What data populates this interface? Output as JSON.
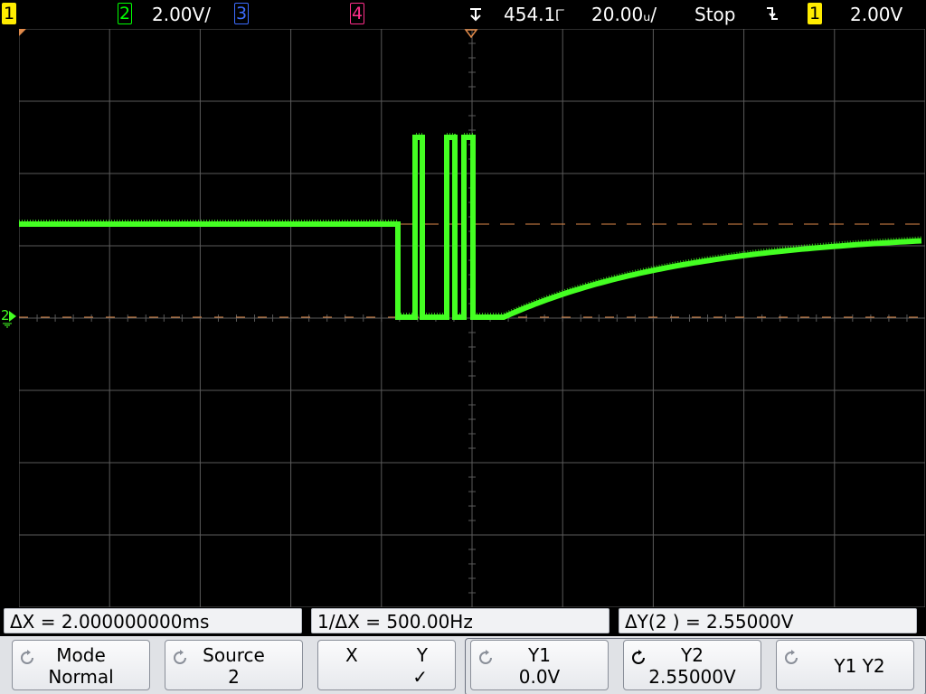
{
  "top_bar": {
    "ch1_badge": "1",
    "ch2_badge": "2",
    "ch2_scale": "2.00V/",
    "ch3_badge": "3",
    "ch4_badge": "4",
    "delay": "454.1୮",
    "delay_icon": "delay-arrow-icon",
    "time_scale": "20.00ᵤ/",
    "run_state": "Stop",
    "trigger_slope_icon": "falling-edge-icon",
    "trigger_source_badge": "1",
    "trigger_level": "2.00V"
  },
  "screen": {
    "ground_marker_label": "2",
    "colors": {
      "grid": "#5a5a5a",
      "trace": "#44ff22",
      "cursor_line": "#e08a4a"
    }
  },
  "readouts": {
    "delta_x": "ΔX = 2.000000000ms",
    "inverse_delta_x": "1/ΔX = 500.00Hz",
    "delta_y": "ΔY(2 ) = 2.55000V"
  },
  "softkeys": {
    "mode": {
      "line1": "Mode",
      "line2": "Normal"
    },
    "source": {
      "line1": "Source",
      "line2": "2"
    },
    "xy": {
      "x": "X",
      "y": "Y",
      "check": "✓"
    },
    "y1": {
      "line1": "Y1",
      "line2": "0.0V"
    },
    "y2": {
      "line1": "Y2",
      "line2": "2.55000V"
    },
    "y1y2": {
      "line1": "Y1 Y2"
    }
  }
}
